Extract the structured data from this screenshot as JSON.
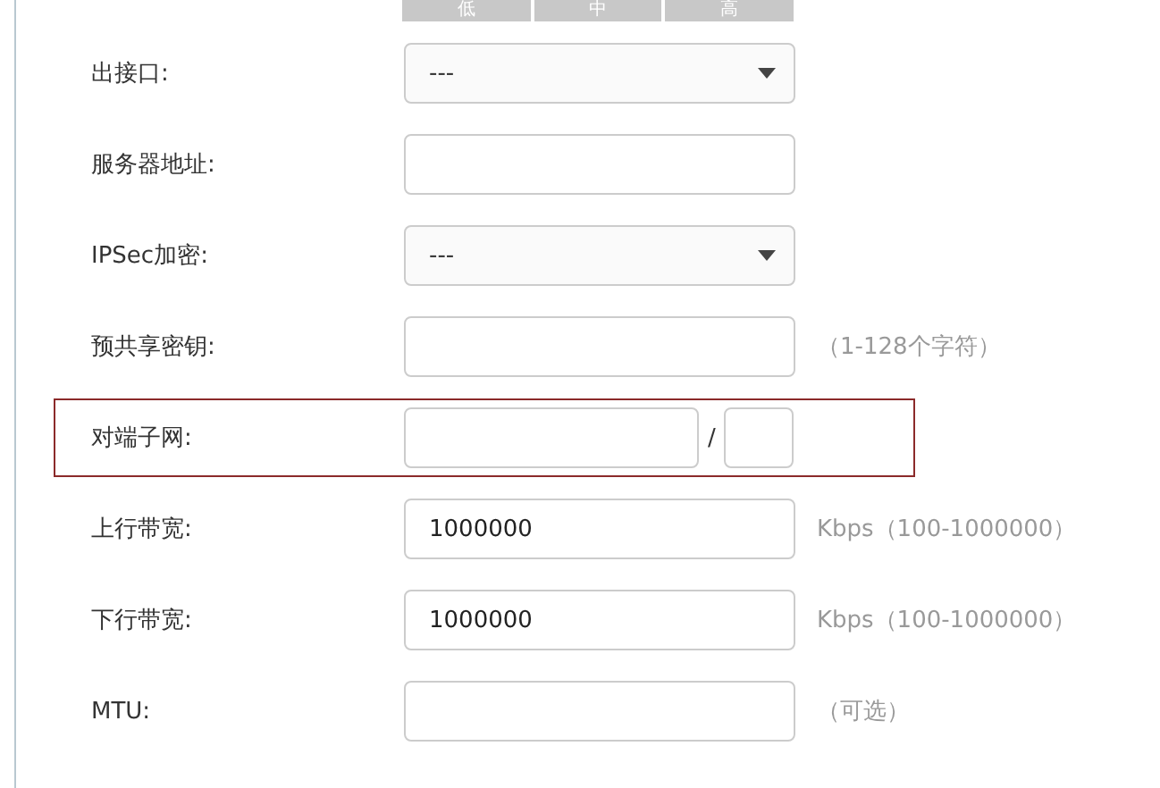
{
  "strength_meter": {
    "levels": [
      "低",
      "中",
      "高"
    ]
  },
  "fields": [
    {
      "kind": "select",
      "label": "出接口:",
      "value": "---",
      "highlighted": false
    },
    {
      "kind": "text",
      "label": "服务器地址:",
      "highlighted": false
    },
    {
      "kind": "select",
      "label": "IPSec加密:",
      "value": "---",
      "highlighted": false
    },
    {
      "kind": "text",
      "label": "预共享密钥:",
      "hint": "（1-128个字符）",
      "highlighted": false
    },
    {
      "kind": "subnet",
      "label": "对端子网:",
      "separator": "/",
      "highlighted": true
    },
    {
      "kind": "text",
      "label": "上行带宽:",
      "value": "1000000",
      "hint": "Kbps（100-1000000）",
      "highlighted": false
    },
    {
      "kind": "text",
      "label": "下行带宽:",
      "value": "1000000",
      "hint": "Kbps（100-1000000）",
      "highlighted": false
    },
    {
      "kind": "text",
      "label": "MTU:",
      "hint": "（可选）",
      "highlighted": false
    }
  ]
}
